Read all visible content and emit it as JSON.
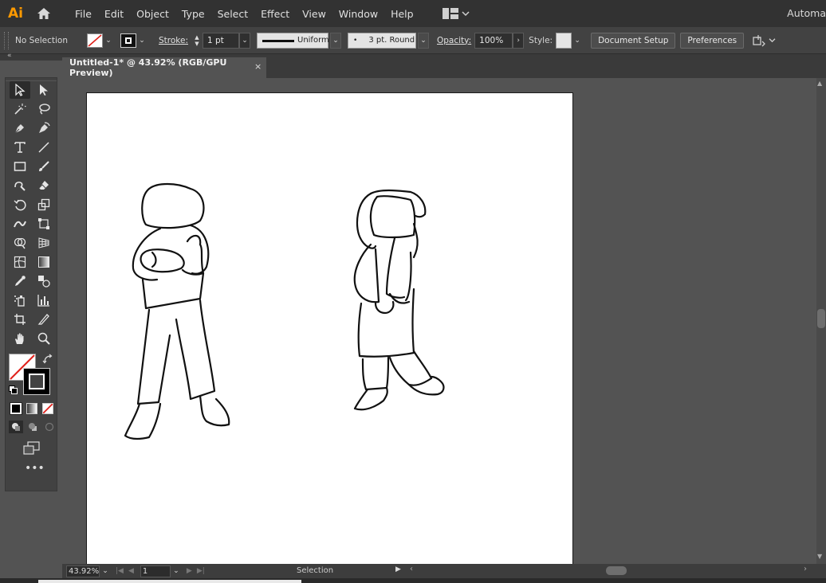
{
  "app": {
    "logo_text": "Ai",
    "workspace_label": "Automa"
  },
  "menu": [
    "File",
    "Edit",
    "Object",
    "Type",
    "Select",
    "Effect",
    "View",
    "Window",
    "Help"
  ],
  "control": {
    "selection_status": "No Selection",
    "stroke_label": "Stroke:",
    "stroke_weight": "1 pt",
    "profile_label": "Uniform",
    "brush_label": "3 pt. Round",
    "opacity_label": "Opacity:",
    "opacity_value": "100%",
    "style_label": "Style:",
    "document_setup": "Document Setup",
    "preferences": "Preferences"
  },
  "document": {
    "tab_title": "Untitled-1* @ 43.92% (RGB/GPU Preview)",
    "close_glyph": "×"
  },
  "status": {
    "zoom": "43.92%",
    "artboard_number": "1",
    "current_tool": "Selection"
  },
  "colors": {
    "accent_logo": "#ff9a00",
    "chrome_dark": "#323232",
    "chrome_mid": "#424242",
    "canvas_bg": "#535353",
    "artboard": "#ffffff"
  },
  "icons": [
    "home-icon",
    "workspace-layout-icon",
    "selection-tool-icon",
    "direct-selection-tool-icon",
    "magic-wand-tool-icon",
    "lasso-tool-icon",
    "pen-tool-icon",
    "curvature-tool-icon",
    "type-tool-icon",
    "line-tool-icon",
    "rectangle-tool-icon",
    "paintbrush-tool-icon",
    "shaper-tool-icon",
    "eraser-tool-icon",
    "rotate-tool-icon",
    "scale-tool-icon",
    "width-tool-icon",
    "free-transform-tool-icon",
    "shape-builder-tool-icon",
    "perspective-grid-tool-icon",
    "mesh-tool-icon",
    "gradient-tool-icon",
    "eyedropper-tool-icon",
    "blend-tool-icon",
    "symbol-sprayer-tool-icon",
    "column-graph-tool-icon",
    "artboard-tool-icon",
    "slice-tool-icon",
    "hand-tool-icon",
    "zoom-tool-icon",
    "fill-swatch-icon",
    "stroke-swatch-icon",
    "swap-fill-stroke-icon",
    "default-fill-stroke-icon",
    "draw-normal-icon",
    "change-screen-mode-icon",
    "edit-toolbar-icon"
  ]
}
